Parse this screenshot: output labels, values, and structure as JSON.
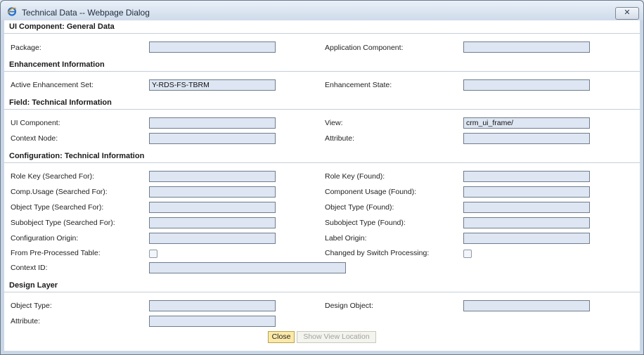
{
  "window": {
    "title": "Technical Data -- Webpage Dialog",
    "close_glyph": "✕"
  },
  "sections": {
    "general": "UI Component: General Data",
    "enhancement": "Enhancement Information",
    "field": "Field: Technical Information",
    "config": "Configuration: Technical Information",
    "design": "Design Layer"
  },
  "general": {
    "package": {
      "label": "Package:",
      "value": ""
    },
    "app_component": {
      "label": "Application Component:",
      "value": ""
    }
  },
  "enhancement": {
    "active_set": {
      "label": "Active Enhancement Set:",
      "value": "Y-RDS-FS-TBRM"
    },
    "state": {
      "label": "Enhancement State:",
      "value": ""
    }
  },
  "field": {
    "ui_component": {
      "label": "UI Component:",
      "value": ""
    },
    "view": {
      "label": "View:",
      "value": "crm_ui_frame/"
    },
    "context_node": {
      "label": "Context Node:",
      "value": ""
    },
    "attribute": {
      "label": "Attribute:",
      "value": ""
    }
  },
  "config": {
    "role_key_searched": {
      "label": "Role Key (Searched For):",
      "value": ""
    },
    "role_key_found": {
      "label": "Role Key (Found):",
      "value": ""
    },
    "comp_usage_searched": {
      "label": "Comp.Usage (Searched For):",
      "value": ""
    },
    "comp_usage_found": {
      "label": "Component Usage (Found):",
      "value": ""
    },
    "object_type_searched": {
      "label": "Object Type (Searched For):",
      "value": ""
    },
    "object_type_found": {
      "label": "Object Type (Found):",
      "value": ""
    },
    "subobject_type_searched": {
      "label": "Subobject Type (Searched For):",
      "value": ""
    },
    "subobject_type_found": {
      "label": "Subobject Type (Found):",
      "value": ""
    },
    "config_origin": {
      "label": "Configuration Origin:",
      "value": ""
    },
    "label_origin": {
      "label": "Label Origin:",
      "value": ""
    },
    "preprocessed": {
      "label": "From Pre-Processed Table:",
      "checked": false
    },
    "switch_processing": {
      "label": "Changed by Switch Processing:",
      "checked": false
    },
    "context_id": {
      "label": "Context ID:",
      "value": ""
    }
  },
  "design": {
    "object_type": {
      "label": "Object Type:",
      "value": ""
    },
    "design_object": {
      "label": "Design Object:",
      "value": ""
    },
    "attribute": {
      "label": "Attribute:",
      "value": ""
    }
  },
  "buttons": {
    "close": "Close",
    "show_view_location": "Show View Location"
  }
}
